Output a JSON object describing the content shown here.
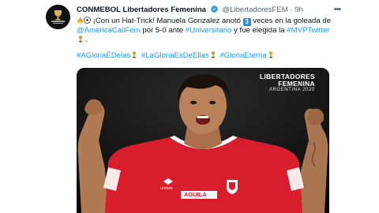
{
  "account": {
    "display_name": "CONMEBOL Libertadores Femenina",
    "handle": "@LibertadoresFEM",
    "separator": "·",
    "timestamp": "9h",
    "avatar_text": "CONMEBOL LIBERTADORES FEMENINA"
  },
  "tweet": {
    "line1_text": "¡Con un Hat-Trick! Manuela Gonzalez anotó",
    "count_badge": "3",
    "line1_rest": "veces en la goleada",
    "line2_prefix": "de",
    "mention_america": "@AmericaCaliFem",
    "line2_middle": "por 5-0 ante",
    "hashtag_universitario": "#Universitario",
    "line2_suffix": "y fue elegida la",
    "hashtag_mvp": "#MVPTwitter",
    "line3_suffix": "."
  },
  "hashtags": [
    "#AGloriaÉDelas",
    "#LaGloriaEsDeEllas",
    "#GloriaEterna"
  ],
  "media": {
    "brand_line1": "LIBERTADORES",
    "brand_line2": "FEMENINA",
    "brand_line3": "ARGENTINA 2020",
    "jersey_sponsor": "AGUILA",
    "jersey_maker": "umbro"
  },
  "colors": {
    "link": "#1d9bf0",
    "secondary_text": "#536471",
    "jersey_red": "#d81e2c",
    "badge_blue": "#3b88c3"
  },
  "icons": {
    "verified": "verified-badge-icon",
    "more": "more-options-icon",
    "fire": "fire-emoji-icon",
    "soccer_ball": "soccer-ball-emoji-icon",
    "trophy": "trophy-emoji-icon"
  }
}
